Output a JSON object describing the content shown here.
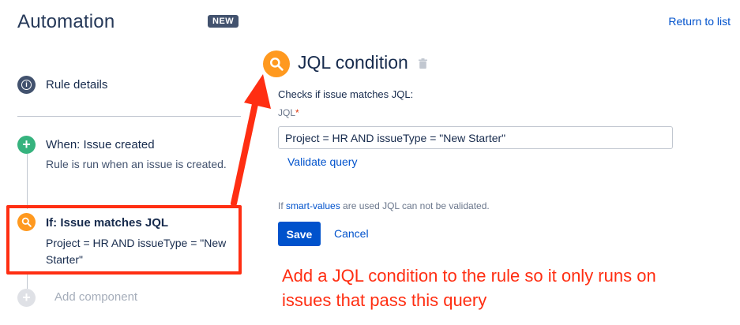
{
  "header": {
    "title": "Automation",
    "badge": "NEW",
    "return_link": "Return to list"
  },
  "sidebar": {
    "rule_details": "Rule details",
    "trigger": {
      "title": "When: Issue created",
      "description": "Rule is run when an issue is created."
    },
    "condition": {
      "title": "If: Issue matches JQL",
      "description": "Project = HR AND issueType = \"New Starter\""
    },
    "add_component": "Add component"
  },
  "panel": {
    "title": "JQL condition",
    "subtitle": "Checks if issue matches JQL:",
    "jql_label": "JQL",
    "required_mark": "*",
    "jql_value": "Project = HR AND issueType = \"New Starter\"",
    "validate_link": "Validate query",
    "smart_note_prefix": "If ",
    "smart_note_link": "smart-values",
    "smart_note_suffix": " are used JQL can not be validated.",
    "save_label": "Save",
    "cancel_label": "Cancel"
  },
  "annotation": {
    "text": "Add a JQL condition to the rule so it only runs on issues that pass this query"
  },
  "colors": {
    "annotation_red": "#ff2e12",
    "condition_orange": "#ff991f",
    "trigger_green": "#36b37e",
    "primary_blue": "#0052cc"
  }
}
